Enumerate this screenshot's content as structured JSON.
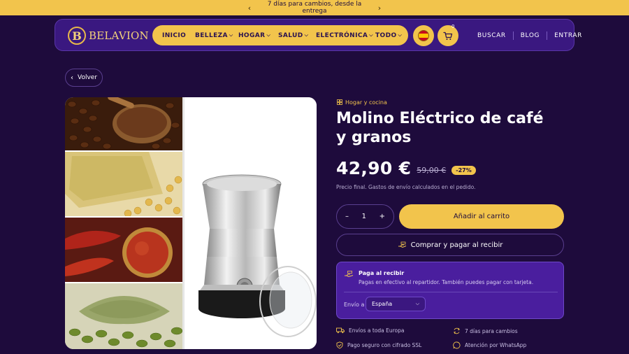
{
  "announcement": {
    "message": "7 días para cambios, desde la entrega",
    "prev_icon": "chevron-left-icon",
    "next_icon": "chevron-right-icon"
  },
  "brand": {
    "initial": "B",
    "name": "BELAVION"
  },
  "nav": {
    "items": [
      {
        "label": "INICIO",
        "dropdown": false
      },
      {
        "label": "BELLEZA",
        "dropdown": true
      },
      {
        "label": "HOGAR",
        "dropdown": true
      },
      {
        "label": "SALUD",
        "dropdown": true
      },
      {
        "label": "ELECTRÓNICA",
        "dropdown": true
      },
      {
        "label": "TODO",
        "dropdown": true
      }
    ]
  },
  "header_actions": {
    "cart_count": "0",
    "links": [
      "BUSCAR",
      "BLOG",
      "ENTRAR"
    ]
  },
  "back": {
    "label": "Volver"
  },
  "product": {
    "category": "Hogar y cocina",
    "title": "Molino Eléctrico de café y granos",
    "price": "42,90 €",
    "old_price": "59,00 €",
    "discount": "-27%",
    "price_note": "Precio final. Gastos de envío calculados en el pedido.",
    "quantity": "1",
    "qty_minus": "–",
    "qty_plus": "+",
    "add_to_cart": "Añadir al carrito",
    "buy_now": "Comprar y pagar al recibir"
  },
  "cod": {
    "heading": "Paga al recibir",
    "description": "Pagas en efectivo al repartidor. También puedes pagar con tarjeta.",
    "ship_label": "Envío a",
    "country": "España"
  },
  "features": [
    {
      "icon": "truck-icon",
      "label": "Envíos a toda Europa"
    },
    {
      "icon": "exchange-icon",
      "label": "7 días para cambios"
    },
    {
      "icon": "shield-icon",
      "label": "Pago seguro con cifrado SSL"
    },
    {
      "icon": "whatsapp-icon",
      "label": "Atención por WhatsApp"
    }
  ],
  "colors": {
    "accent": "#f2c44c",
    "background": "#1e0b3c",
    "header": "#3a1880",
    "cod_box": "#4a1e9e"
  }
}
